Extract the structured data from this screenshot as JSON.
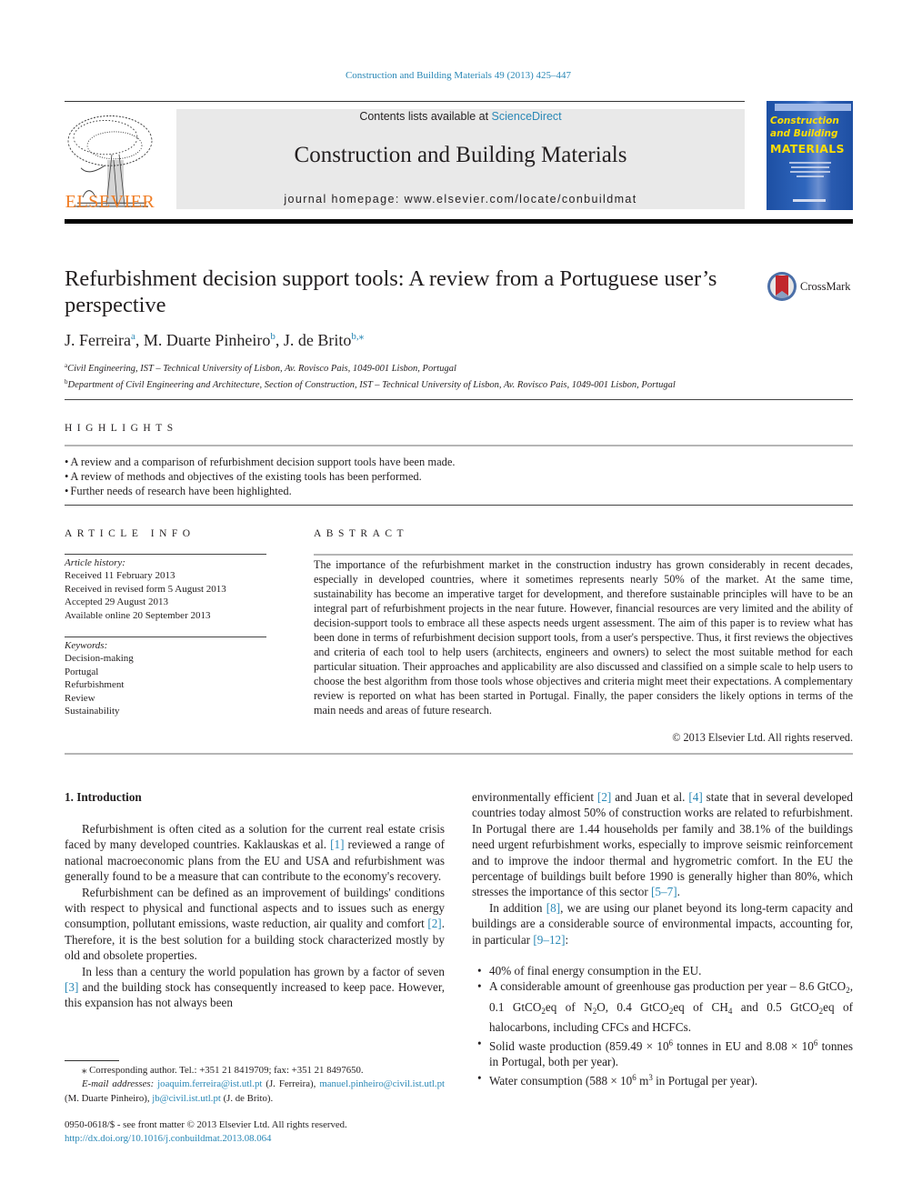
{
  "journal_ref": "Construction and Building Materials 49 (2013) 425–447",
  "header": {
    "publisher": "ELSEVIER",
    "contents_prefix": "Contents lists available at ",
    "contents_link": "ScienceDirect",
    "journal_title": "Construction and Building Materials",
    "homepage": "journal homepage: www.elsevier.com/locate/conbuildmat",
    "cover": {
      "line1": "Construction",
      "line2": "and Building",
      "line3": "MATERIALS"
    }
  },
  "article": {
    "title": "Refurbishment decision support tools: A review from a Portuguese user’s perspective",
    "crossmark_label": "CrossMark",
    "authors": [
      {
        "name": "J. Ferreira",
        "sup": "a"
      },
      {
        "name": "M. Duarte Pinheiro",
        "sup": "b"
      },
      {
        "name": "J. de Brito",
        "sup": "b,⁎"
      }
    ],
    "affiliations": [
      {
        "key": "a",
        "text": "Civil Engineering, IST – Technical University of Lisbon, Av. Rovisco Pais, 1049-001 Lisbon, Portugal"
      },
      {
        "key": "b",
        "text": "Department of Civil Engineering and Architecture, Section of Construction, IST – Technical University of Lisbon, Av. Rovisco Pais, 1049-001 Lisbon, Portugal"
      }
    ]
  },
  "highlights": {
    "heading": "HIGHLIGHTS",
    "items": [
      "A review and a comparison of refurbishment decision support tools have been made.",
      "A review of methods and objectives of the existing tools has been performed.",
      "Further needs of research have been highlighted."
    ]
  },
  "article_info": {
    "heading": "ARTICLE INFO",
    "history_label": "Article history:",
    "history": [
      "Received 11 February 2013",
      "Received in revised form 5 August 2013",
      "Accepted 29 August 2013",
      "Available online 20 September 2013"
    ],
    "keywords_label": "Keywords:",
    "keywords": [
      "Decision-making",
      "Portugal",
      "Refurbishment",
      "Review",
      "Sustainability"
    ]
  },
  "abstract": {
    "heading": "ABSTRACT",
    "text": "The importance of the refurbishment market in the construction industry has grown considerably in recent decades, especially in developed countries, where it sometimes represents nearly 50% of the market. At the same time, sustainability has become an imperative target for development, and therefore sustainable principles will have to be an integral part of refurbishment projects in the near future. However, financial resources are very limited and the ability of decision-support tools to embrace all these aspects needs urgent assessment. The aim of this paper is to review what has been done in terms of refurbishment decision support tools, from a user's perspective. Thus, it first reviews the objectives and criteria of each tool to help users (architects, engineers and owners) to select the most suitable method for each particular situation. Their approaches and applicability are also discussed and classified on a simple scale to help users to choose the best algorithm from those tools whose objectives and criteria might meet their expectations. A complementary review is reported on what has been started in Portugal. Finally, the paper considers the likely options in terms of the main needs and areas of future research.",
    "copyright": "© 2013 Elsevier Ltd. All rights reserved."
  },
  "body": {
    "section_title": "1. Introduction",
    "p1": {
      "a": "Refurbishment is often cited as a solution for the current real estate crisis faced by many developed countries. Kaklauskas et al. ",
      "ref": "[1]",
      "b": " reviewed a range of national macroeconomic plans from the EU and USA and refurbishment was generally found to be a measure that can contribute to the economy's recovery."
    },
    "p2": {
      "a": "Refurbishment can be defined as an improvement of buildings' conditions with respect to physical and functional aspects and to issues such as energy consumption, pollutant emissions, waste reduction, air quality and comfort ",
      "ref": "[2]",
      "b": ". Therefore, it is the best solution for a building stock characterized mostly by old and obsolete properties."
    },
    "p3": {
      "a": "In less than a century the world population has grown by a factor of seven ",
      "ref": "[3]",
      "b": " and the building stock has consequently increased to keep pace. However, this expansion has not always been"
    },
    "p4": {
      "a": "environmentally efficient ",
      "ref1": "[2]",
      "b": " and Juan et al. ",
      "ref2": "[4]",
      "c": " state that in several developed countries today almost 50% of construction works are related to refurbishment. In Portugal there are 1.44 households per family and 38.1% of the buildings need urgent refurbishment works, especially to improve seismic reinforcement and to improve the indoor thermal and hygrometric comfort. In the EU the percentage of buildings built before 1990 is generally higher than 80%, which stresses the importance of this sector ",
      "ref3": "[5–7]",
      "d": "."
    },
    "p5": {
      "a": "In addition ",
      "ref1": "[8]",
      "b": ", we are using our planet beyond its long-term capacity and buildings are a considerable source of environmental impacts, accounting for, in particular ",
      "ref2": "[9–12]",
      "c": ":"
    },
    "bullets": {
      "b1": "40% of final energy consumption in the EU.",
      "b2": {
        "t1": "A considerable amount of greenhouse gas production per year – 8.6 GtCO",
        "s1": "2",
        "t2": ", 0.1 GtCO",
        "s2": "2",
        "t3": "eq of N",
        "s3": "2",
        "t4": "O, 0.4 GtCO",
        "s4": "2",
        "t5": "eq of CH",
        "s5": "4",
        "t6": " and 0.5 GtCO",
        "s6": "2",
        "t7": "eq of halocarbons, including CFCs and HCFCs."
      },
      "b3": {
        "t1": "Solid waste production (859.49 × 10",
        "p1": "6",
        "t2": " tonnes in EU and 8.08 × 10",
        "p2": "6",
        "t3": " tonnes in Portugal, both per year)."
      },
      "b4": {
        "t1": "Water consumption (588 × 10",
        "p1": "6",
        "t2": " m",
        "p2": "3",
        "t3": " in Portugal per year)."
      }
    }
  },
  "footnotes": {
    "corresponding": "⁎ Corresponding author. Tel.: +351 21 8419709; fax: +351 21 8497650.",
    "email_label": "E-mail addresses:",
    "email1": "joaquim.ferreira@ist.utl.pt",
    "email1_owner": " (J. Ferreira), ",
    "email2": "manuel.pinheiro@civil.ist.utl.pt",
    "email2_owner": " (M. Duarte Pinheiro), ",
    "email3": "jb@civil.ist.utl.pt",
    "email3_owner": " (J. de Brito).",
    "issn": "0950-0618/$ - see front matter © 2013 Elsevier Ltd. All rights reserved.",
    "doi": "http://dx.doi.org/10.1016/j.conbuildmat.2013.08.064"
  },
  "colors": {
    "link": "#2a88b6",
    "elsevier_orange": "#f07e26",
    "cover_blue": "#1d4fa3",
    "cover_yellow": "#ffde00",
    "banner_gray": "#e9e9e9"
  }
}
